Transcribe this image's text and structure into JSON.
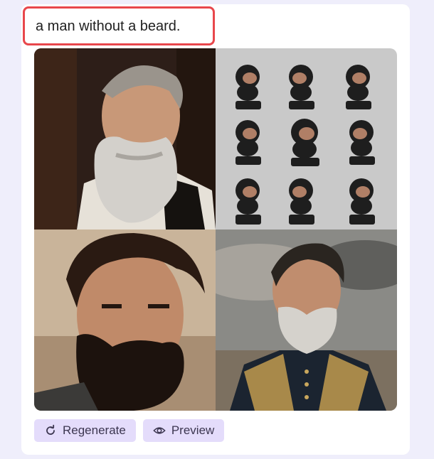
{
  "prompt": {
    "text": "a man without a beard."
  },
  "images": [
    {
      "alt": "man-with-gray-beard"
    },
    {
      "alt": "beard-style-grid"
    },
    {
      "alt": "man-with-dark-beard"
    },
    {
      "alt": "man-in-ornate-coat"
    }
  ],
  "actions": {
    "regenerate": {
      "label": "Regenerate",
      "icon": "refresh-icon"
    },
    "preview": {
      "label": "Preview",
      "icon": "eye-icon"
    }
  },
  "colors": {
    "accent": "#e4dcfb",
    "highlight": "#e8474c",
    "background": "#efeefb"
  }
}
